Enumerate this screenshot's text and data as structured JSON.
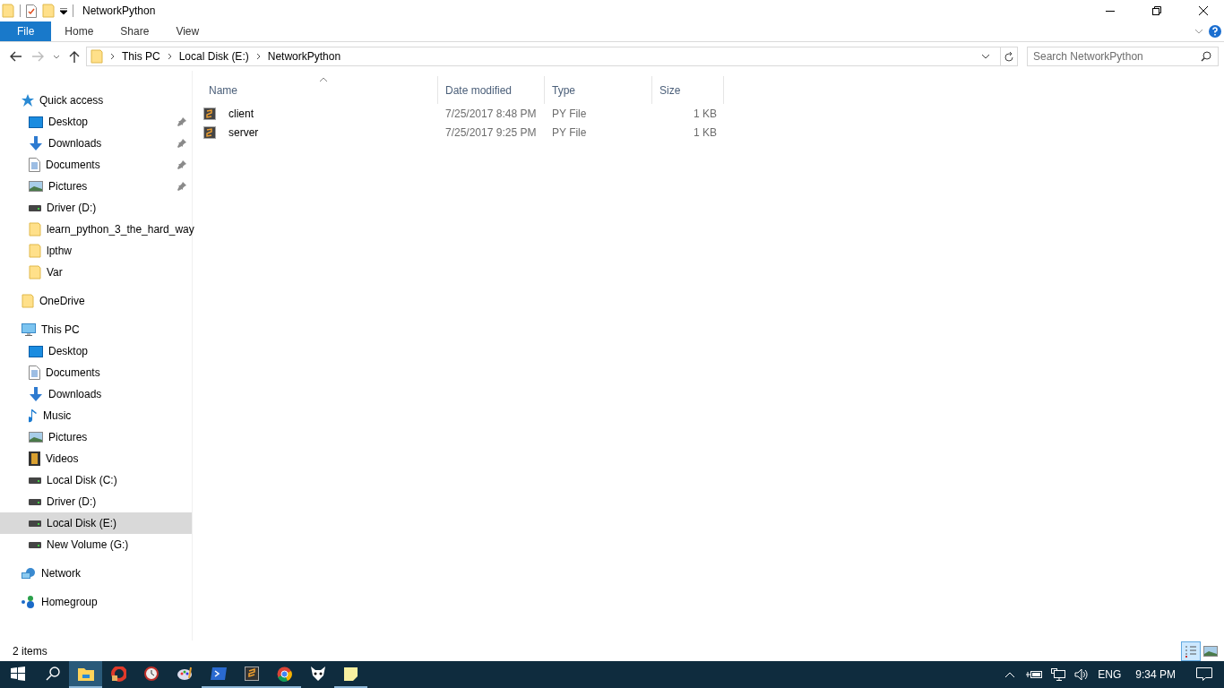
{
  "window": {
    "title": "NetworkPython"
  },
  "ribbon_tabs": [
    {
      "label": "File",
      "kind": "file"
    },
    {
      "label": "Home",
      "kind": "tab"
    },
    {
      "label": "Share",
      "kind": "tab"
    },
    {
      "label": "View",
      "kind": "tab"
    }
  ],
  "address": {
    "breadcrumbs": [
      "This PC",
      "Local Disk (E:)",
      "NetworkPython"
    ],
    "search_placeholder": "Search NetworkPython"
  },
  "sidebar": [
    {
      "label": "Quick access",
      "kind": "star",
      "selected": false,
      "children": [
        {
          "label": "Desktop",
          "kind": "desktop",
          "pinned": true,
          "selected": false
        },
        {
          "label": "Downloads",
          "kind": "download",
          "pinned": true,
          "selected": false
        },
        {
          "label": "Documents",
          "kind": "documents",
          "pinned": true,
          "selected": false
        },
        {
          "label": "Pictures",
          "kind": "pictures",
          "pinned": true,
          "selected": false
        },
        {
          "label": "Driver (D:)",
          "kind": "drive",
          "pinned": false,
          "selected": false
        },
        {
          "label": "learn_python_3_the_hard_way",
          "kind": "folder",
          "pinned": false,
          "selected": false
        },
        {
          "label": "lpthw",
          "kind": "folder",
          "pinned": false,
          "selected": false
        },
        {
          "label": "Var",
          "kind": "folder",
          "pinned": false,
          "selected": false
        }
      ]
    },
    {
      "label": "OneDrive",
      "kind": "folder",
      "selected": false
    },
    {
      "label": "This PC",
      "kind": "pc",
      "selected": false,
      "children": [
        {
          "label": "Desktop",
          "kind": "desktop",
          "pinned": false,
          "selected": false
        },
        {
          "label": "Documents",
          "kind": "documents",
          "pinned": false,
          "selected": false
        },
        {
          "label": "Downloads",
          "kind": "download",
          "pinned": false,
          "selected": false
        },
        {
          "label": "Music",
          "kind": "music",
          "pinned": false,
          "selected": false
        },
        {
          "label": "Pictures",
          "kind": "pictures",
          "pinned": false,
          "selected": false
        },
        {
          "label": "Videos",
          "kind": "videos",
          "pinned": false,
          "selected": false
        },
        {
          "label": "Local Disk (C:)",
          "kind": "drive",
          "pinned": false,
          "selected": false
        },
        {
          "label": "Driver (D:)",
          "kind": "drive",
          "pinned": false,
          "selected": false
        },
        {
          "label": "Local Disk (E:)",
          "kind": "drive",
          "pinned": false,
          "selected": true
        },
        {
          "label": "New Volume (G:)",
          "kind": "drive",
          "pinned": false,
          "selected": false
        }
      ]
    },
    {
      "label": "Network",
      "kind": "network",
      "selected": false
    },
    {
      "label": "Homegroup",
      "kind": "homegroup",
      "selected": false
    }
  ],
  "table": {
    "columns": [
      {
        "label": "Name",
        "sorted": true
      },
      {
        "label": "Date modified",
        "sorted": false
      },
      {
        "label": "Type",
        "sorted": false
      },
      {
        "label": "Size",
        "sorted": false
      }
    ],
    "rows": [
      {
        "name": "client",
        "date": "7/25/2017 8:48 PM",
        "type": "PY File",
        "size": "1 KB"
      },
      {
        "name": "server",
        "date": "7/25/2017 9:25 PM",
        "type": "PY File",
        "size": "1 KB"
      }
    ]
  },
  "status_bar": {
    "text": "2 items",
    "views": [
      {
        "kind": "details",
        "selected": true
      },
      {
        "kind": "large",
        "selected": false
      }
    ]
  },
  "taskbar": {
    "apps": [
      {
        "kind": "explorer",
        "running": true,
        "active": true
      },
      {
        "kind": "cleaner",
        "running": false,
        "active": false
      },
      {
        "kind": "clock",
        "running": false,
        "active": false
      },
      {
        "kind": "paint",
        "running": false,
        "active": false
      },
      {
        "kind": "shell",
        "running": true,
        "active": false
      },
      {
        "kind": "sublime",
        "running": true,
        "active": false
      },
      {
        "kind": "chrome",
        "running": true,
        "active": false
      },
      {
        "kind": "mask",
        "running": false,
        "active": false
      },
      {
        "kind": "notes",
        "running": true,
        "active": false
      }
    ],
    "language": "ENG",
    "time": "9:34 PM"
  }
}
